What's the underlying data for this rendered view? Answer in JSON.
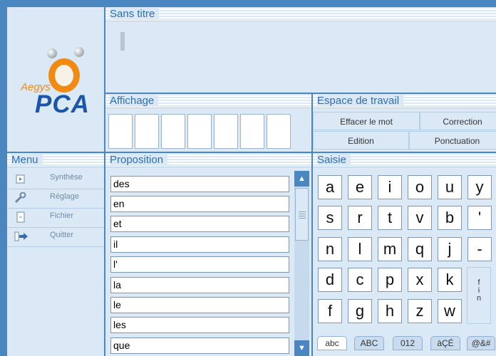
{
  "logo": {
    "brand": "Aegys",
    "product": "PCA"
  },
  "document": {
    "title": "Sans titre"
  },
  "affichage": {
    "title": "Affichage"
  },
  "espace": {
    "title": "Espace de travail",
    "buttons": [
      "Effacer le mot",
      "Correction",
      "Edition",
      "Ponctuation"
    ]
  },
  "menu": {
    "title": "Menu",
    "items": [
      {
        "label": "Synthèse",
        "icon": "play-icon"
      },
      {
        "label": "Réglage",
        "icon": "wrench-icon"
      },
      {
        "label": "Fichier",
        "icon": "file-icon"
      },
      {
        "label": "Quitter",
        "icon": "exit-arrow-icon"
      }
    ]
  },
  "proposition": {
    "title": "Proposition",
    "words": [
      "des",
      "en",
      "et",
      "il",
      "l'",
      "la",
      "le",
      "les",
      "que"
    ]
  },
  "saisie": {
    "title": "Saisie",
    "keys": [
      [
        "a",
        "e",
        "i",
        "o",
        "u",
        "y"
      ],
      [
        "s",
        "r",
        "t",
        "v",
        "b",
        "'"
      ],
      [
        "n",
        "l",
        "m",
        "q",
        "j",
        "-"
      ],
      [
        "d",
        "c",
        "p",
        "x",
        "k"
      ],
      [
        "f",
        "g",
        "h",
        "z",
        "w"
      ]
    ],
    "fin_key": "fin",
    "tabs": [
      "abc",
      "ABC",
      "012",
      "àÇÉ",
      "@&#"
    ],
    "active_tab": "abc"
  },
  "colors": {
    "background": "#4a86c0",
    "panel": "#dbe9f7",
    "title": "#2f6db0",
    "accent": "#f08a12"
  }
}
